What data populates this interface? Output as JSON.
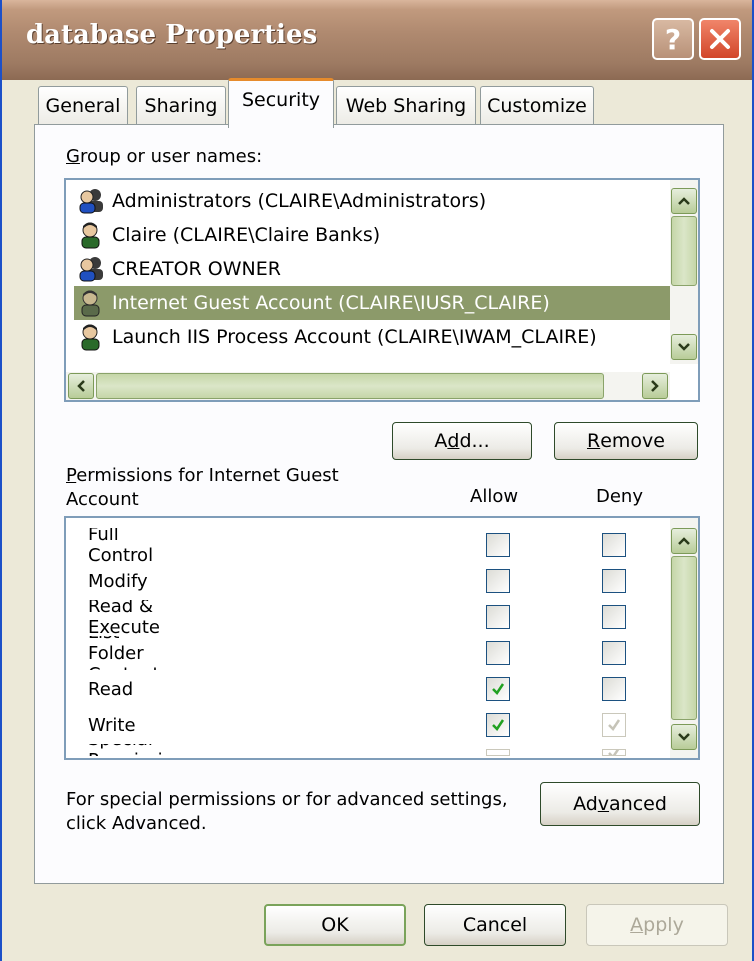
{
  "window": {
    "title": "database Properties",
    "help_label": "?",
    "close_label": "✕"
  },
  "tabs": [
    {
      "label": "General",
      "active": false
    },
    {
      "label": "Sharing",
      "active": false
    },
    {
      "label": "Security",
      "active": true
    },
    {
      "label": "Web Sharing",
      "active": false
    },
    {
      "label": "Customize",
      "active": false
    }
  ],
  "users": {
    "label_prefix": "G",
    "label_rest": "roup or user names:",
    "items": [
      {
        "label": "Administrators (CLAIRE\\Administrators)",
        "icon": "group-icon",
        "selected": false
      },
      {
        "label": "Claire (CLAIRE\\Claire Banks)",
        "icon": "user-icon",
        "selected": false
      },
      {
        "label": "CREATOR OWNER",
        "icon": "group-icon",
        "selected": false
      },
      {
        "label": "Internet Guest Account (CLAIRE\\IUSR_CLAIRE)",
        "icon": "user-icon",
        "selected": true
      },
      {
        "label": "Launch IIS Process Account (CLAIRE\\IWAM_CLAIRE)",
        "icon": "user-icon",
        "selected": false
      }
    ]
  },
  "buttons": {
    "add_pre": "A",
    "add_mn": "d",
    "add_post": "d...",
    "remove_mn": "R",
    "remove_post": "emove",
    "advanced_pre": "Ad",
    "advanced_mn": "v",
    "advanced_post": "anced",
    "ok": "OK",
    "cancel": "Cancel",
    "apply_mn": "A",
    "apply_post": "pply"
  },
  "permissions": {
    "label_mn": "P",
    "label_line1": "ermissions for Internet Guest",
    "label_line2": "Account",
    "allow_header": "Allow",
    "deny_header": "Deny",
    "items": [
      {
        "label": "Full Control",
        "allow": false,
        "deny": false,
        "allow_enabled": true,
        "deny_enabled": true
      },
      {
        "label": "Modify",
        "allow": false,
        "deny": false,
        "allow_enabled": true,
        "deny_enabled": true
      },
      {
        "label": "Read & Execute",
        "allow": false,
        "deny": false,
        "allow_enabled": true,
        "deny_enabled": true
      },
      {
        "label": "List Folder Contents",
        "allow": false,
        "deny": false,
        "allow_enabled": true,
        "deny_enabled": true
      },
      {
        "label": "Read",
        "allow": true,
        "deny": false,
        "allow_enabled": true,
        "deny_enabled": true
      },
      {
        "label": "Write",
        "allow": true,
        "deny": true,
        "allow_enabled": true,
        "deny_enabled": false
      },
      {
        "label": "Special Permissions",
        "allow": false,
        "deny": true,
        "allow_enabled": false,
        "deny_enabled": false
      }
    ]
  },
  "advanced_text": {
    "line1": "For special permissions or for advanced settings,",
    "line2": "click Advanced."
  },
  "colors": {
    "selection": "#8c9a6a",
    "check": "#21a121",
    "title_bar": "#b08a70"
  }
}
